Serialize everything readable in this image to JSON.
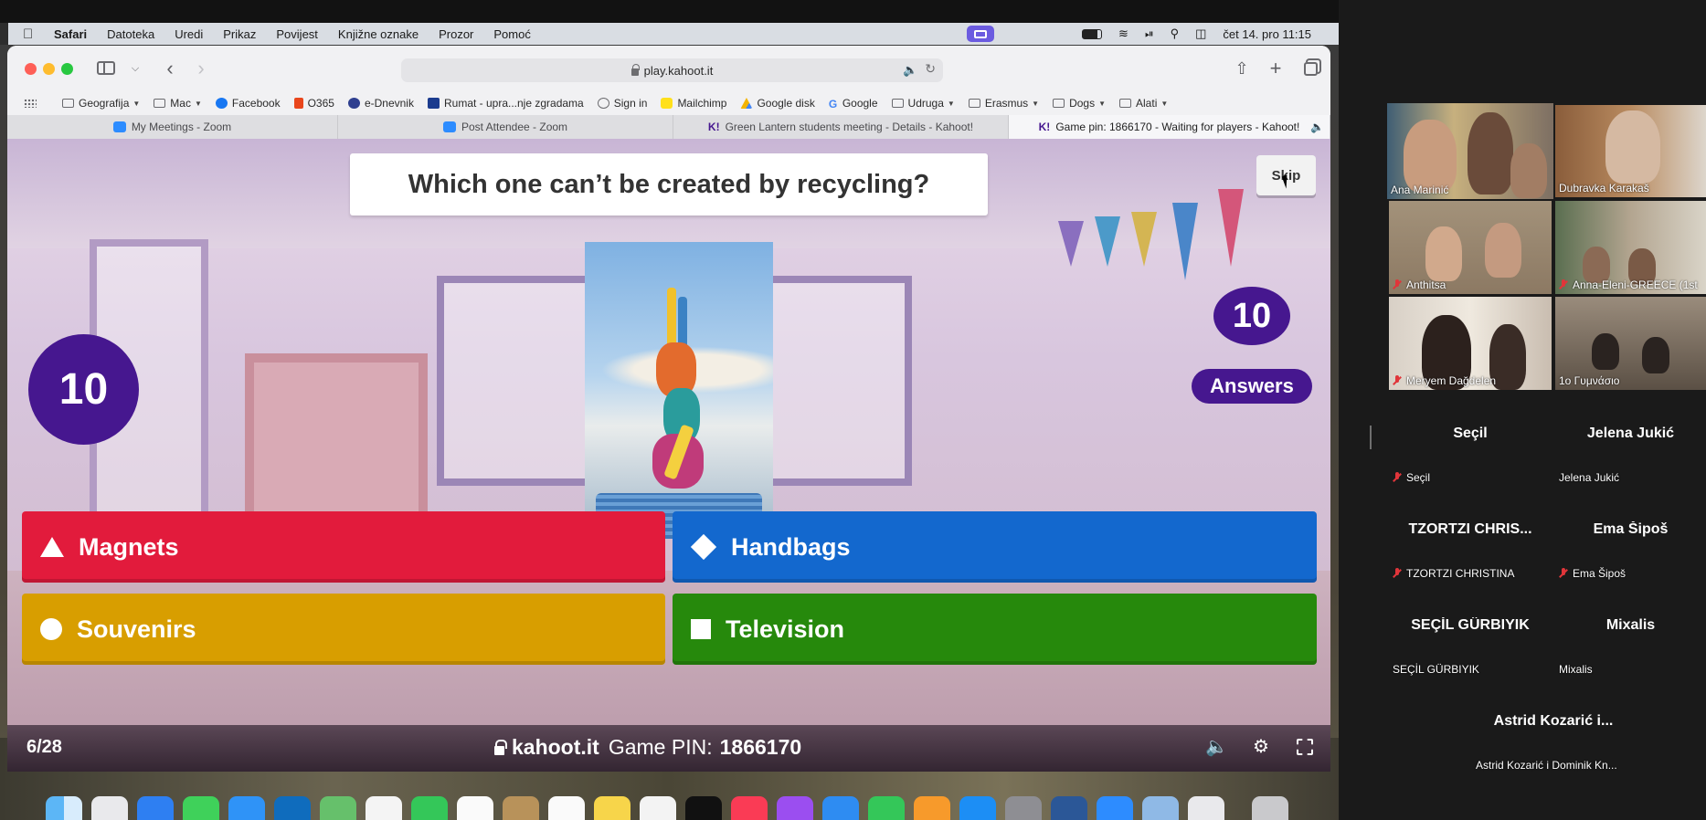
{
  "mac_menubar": {
    "apple_icon": "apple-logo",
    "items": [
      "Safari",
      "Datoteka",
      "Uredi",
      "Prikaz",
      "Povijest",
      "Knjižne oznake",
      "Prozor",
      "Pomoć"
    ],
    "clock": "čet 14. pro  11:15"
  },
  "browser": {
    "url": "play.kahoot.it",
    "bookmarks": [
      {
        "label": "Geografija",
        "icon": "folder",
        "dropdown": true
      },
      {
        "label": "Mac",
        "icon": "folder",
        "dropdown": true
      },
      {
        "label": "Facebook",
        "icon": "facebook",
        "dropdown": false
      },
      {
        "label": "O365",
        "icon": "office",
        "dropdown": false
      },
      {
        "label": "e-Dnevnik",
        "icon": "ednevnik",
        "dropdown": false
      },
      {
        "label": "Rumat - upra...nje zgradama",
        "icon": "rumat",
        "dropdown": false
      },
      {
        "label": "Sign in",
        "icon": "globe",
        "dropdown": false
      },
      {
        "label": "Mailchimp",
        "icon": "mailchimp",
        "dropdown": false
      },
      {
        "label": "Google disk",
        "icon": "gdrive",
        "dropdown": false
      },
      {
        "label": "Google",
        "icon": "google",
        "dropdown": false
      },
      {
        "label": "Udruga",
        "icon": "folder",
        "dropdown": true
      },
      {
        "label": "Erasmus",
        "icon": "folder",
        "dropdown": true
      },
      {
        "label": "Dogs",
        "icon": "folder",
        "dropdown": true
      },
      {
        "label": "Alati",
        "icon": "folder",
        "dropdown": true
      }
    ],
    "tabs": [
      {
        "label": "My Meetings - Zoom",
        "icon": "zoom"
      },
      {
        "label": "Post Attendee - Zoom",
        "icon": "zoom"
      },
      {
        "label": "Green Lantern students meeting - Details - Kahoot!",
        "icon": "kahoot"
      },
      {
        "label": "Game pin: 1866170 - Waiting for players - Kahoot!",
        "icon": "kahoot",
        "active": true
      }
    ]
  },
  "game": {
    "question": "Which one can’t be created by recycling?",
    "skip_label": "Skip",
    "timer": "10",
    "answers_count": "10",
    "answers_label": "Answers",
    "answers": [
      {
        "label": "Magnets",
        "shape": "triangle",
        "color": "#e21b3c"
      },
      {
        "label": "Handbags",
        "shape": "diamond",
        "color": "#1368ce"
      },
      {
        "label": "Souvenirs",
        "shape": "circle",
        "color": "#d89e00"
      },
      {
        "label": "Television",
        "shape": "square",
        "color": "#26890c"
      }
    ],
    "footer": {
      "progress": "6/28",
      "domain": "kahoot.it",
      "pin_label": "Game PIN:",
      "pin": "1866170"
    }
  },
  "zoom": {
    "participants": [
      {
        "display_name": "Ana Marinić",
        "video": true,
        "muted": false,
        "speaking": true
      },
      {
        "display_name": "Dubravka Karakaš",
        "video": true,
        "muted": false
      },
      {
        "display_name": "Anthitsa",
        "video": true,
        "muted": true
      },
      {
        "display_name": "Anna-Eleni-GREECE (1st",
        "video": true,
        "muted": true
      },
      {
        "display_name": "Meryem Dağdelen",
        "video": true,
        "muted": true
      },
      {
        "display_name": "1o   Γυμνάσιο",
        "video": true,
        "muted": false
      },
      {
        "display_name": "Seçil",
        "center_name": "Seçil",
        "video": false,
        "muted": true
      },
      {
        "display_name": "Jelena Jukić",
        "center_name": "Jelena Jukić",
        "video": false,
        "muted": false
      },
      {
        "display_name": "TZORTZI CHRISTINA",
        "center_name": "TZORTZI  CHRIS...",
        "video": false,
        "muted": true
      },
      {
        "display_name": "Ema Šipoš",
        "center_name": "Ema Šipoš",
        "video": false,
        "muted": true
      },
      {
        "display_name": "SEÇİL GÜRBIYIK",
        "center_name": "SEÇİL GÜRBIYIK",
        "video": false,
        "muted": false
      },
      {
        "display_name": "Mixalis",
        "center_name": "Mixalis",
        "video": false,
        "muted": false
      },
      {
        "display_name": "Astrid Kozarić i Dominik Kn...",
        "center_name": "Astrid Kozarić i...",
        "video": false,
        "muted": false
      }
    ]
  }
}
